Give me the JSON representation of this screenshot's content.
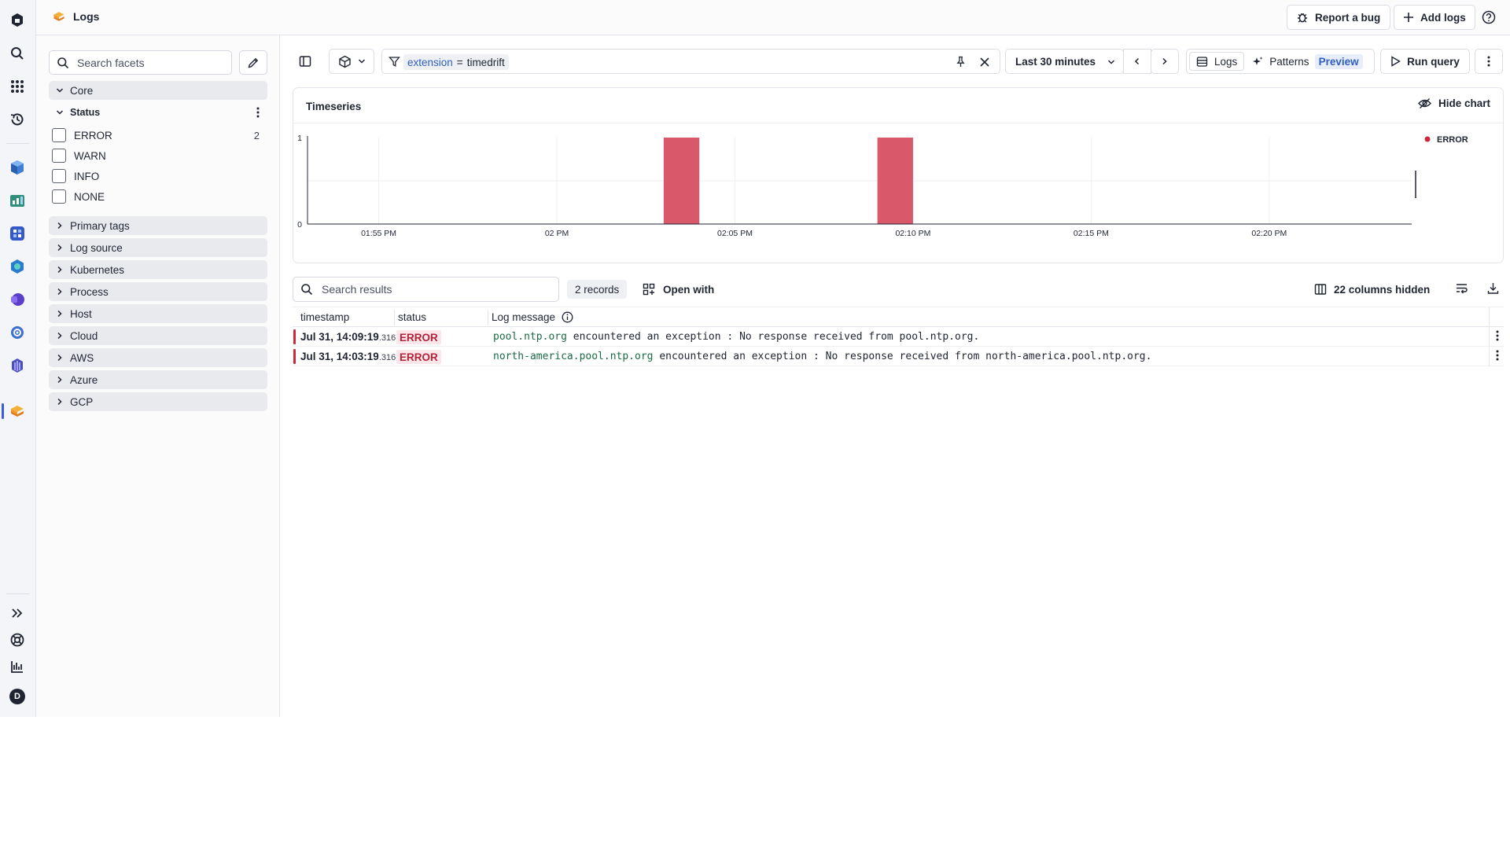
{
  "app": {
    "title": "Logs"
  },
  "topbar": {
    "report_bug": "Report a bug",
    "add_logs": "Add logs"
  },
  "rail": {
    "top_icons": [
      "dynatrace-logo-icon",
      "search-icon",
      "apps-grid-icon",
      "recent-history-icon"
    ],
    "app_icons": [
      "cube-app-icon",
      "chart-app-icon",
      "dashboard-app-icon",
      "kubernetes-app-icon",
      "notebook-app-icon",
      "settings-app-icon",
      "extensions-app-icon",
      "logs-app-icon"
    ],
    "bottom_icons": [
      "expand-rail-icon",
      "help-lifebuoy-icon",
      "analytics-icon"
    ],
    "avatar_initial": "D"
  },
  "facets": {
    "search_placeholder": "Search facets",
    "core_label": "Core",
    "status_label": "Status",
    "status_items": [
      {
        "label": "ERROR",
        "count": "2"
      },
      {
        "label": "WARN",
        "count": ""
      },
      {
        "label": "INFO",
        "count": ""
      },
      {
        "label": "NONE",
        "count": ""
      }
    ],
    "groups": [
      "Primary tags",
      "Log source",
      "Kubernetes",
      "Process",
      "Host",
      "Cloud",
      "AWS",
      "Azure",
      "GCP"
    ]
  },
  "toolbar": {
    "filter_text": "extension = timedrift",
    "filter_key": "extension",
    "filter_op": "=",
    "filter_value": "timedrift",
    "timeframe": "Last 30 minutes",
    "logs_label": "Logs",
    "patterns_label": "Patterns",
    "preview_label": "Preview",
    "run_query": "Run query"
  },
  "chart": {
    "title": "Timeseries",
    "hide_label": "Hide chart",
    "legend": "ERROR",
    "bar_color": "#d9596a",
    "legend_color": "#c9283d"
  },
  "chart_data": {
    "type": "bar",
    "title": "Timeseries",
    "x_ticks": [
      "01:55 PM",
      "02 PM",
      "02:05 PM",
      "02:10 PM",
      "02:15 PM",
      "02:20 PM"
    ],
    "x_range": [
      "01:53 PM",
      "02:24 PM"
    ],
    "y_ticks": [
      "0",
      "1"
    ],
    "ylim": [
      0,
      1
    ],
    "grid": true,
    "legend_position": "top-right",
    "series": [
      {
        "name": "ERROR",
        "color": "#d9596a",
        "points": [
          {
            "x_start": "14:03",
            "x_end": "14:04",
            "value": 1
          },
          {
            "x_start": "14:09",
            "x_end": "14:10",
            "value": 1
          }
        ]
      }
    ]
  },
  "results": {
    "search_placeholder": "Search results",
    "records": "2 records",
    "open_with": "Open with",
    "columns_hidden": "22 columns hidden",
    "columns": [
      "timestamp",
      "status",
      "Log message"
    ],
    "rows": [
      {
        "ts": "Jul 31, 14:09:19",
        "ms": ".316",
        "status": "ERROR",
        "host": "pool.ntp.org",
        "rest": " encountered an exception : No response received from pool.ntp.org."
      },
      {
        "ts": "Jul 31, 14:03:19",
        "ms": ".316",
        "status": "ERROR",
        "host": "north-america.pool.ntp.org",
        "rest": " encountered an exception : No response received from north-america.pool.ntp.org."
      }
    ]
  }
}
